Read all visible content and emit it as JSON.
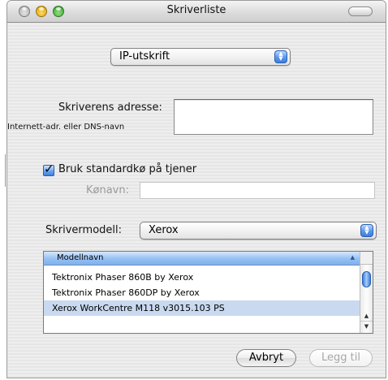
{
  "window": {
    "title": "Skriverliste"
  },
  "protocol_popup": {
    "selected": "IP-utskrift"
  },
  "address": {
    "label": "Skriverens adresse:",
    "hint": "Internett-adr. eller DNS-navn",
    "value": ""
  },
  "default_queue": {
    "label": "Bruk standardkø på tjener",
    "checked": true
  },
  "queue_name": {
    "label": "Kønavn:",
    "value": ""
  },
  "printer_model": {
    "label": "Skrivermodell:",
    "selected": "Xerox"
  },
  "model_list": {
    "column_header": "Modellnavn",
    "rows": [
      "Tektronix Phaser 860B by Xerox",
      "Tektronix Phaser 860DP by Xerox",
      "Xerox WorkCentre M118 v3015.103 PS"
    ],
    "selected_index": 2
  },
  "buttons": {
    "cancel": "Avbryt",
    "add": "Legg til"
  },
  "colors": {
    "selection": "#c9daf0",
    "accent": "#3c7edc"
  }
}
